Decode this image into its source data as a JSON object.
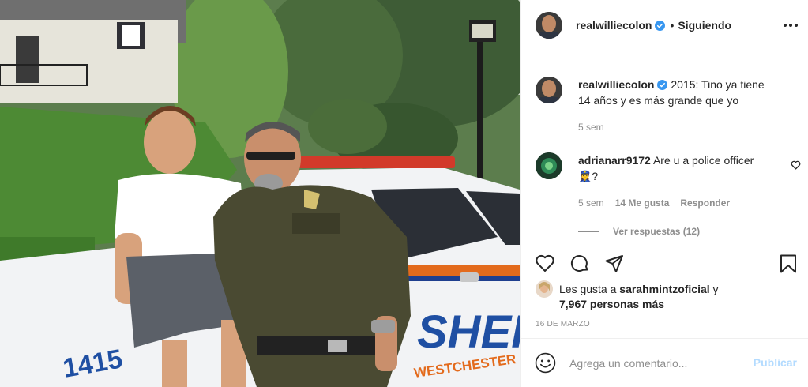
{
  "post": {
    "username": "realwilliecolon",
    "verified": true,
    "follow_separator": "•",
    "follow_label": "Siguiendo",
    "photo_text": {
      "plate_number": "1415",
      "car_label": "SHERIF",
      "car_sublabel": "WESTCHESTER COU"
    }
  },
  "caption": {
    "username": "realwilliecolon",
    "text": "2015: Tino ya tiene 14 años y es más grande que yo",
    "time": "5 sem"
  },
  "comments": [
    {
      "username": "adrianarr9172",
      "text": "Are u a police officer 👮‍♀️?",
      "time": "5 sem",
      "likes": "14 Me gusta",
      "reply_label": "Responder",
      "replies_label": "Ver respuestas (12)"
    }
  ],
  "likes": {
    "prefix": "Les gusta a ",
    "user": "sarahmintzoficial",
    "suffix": " y",
    "others": "7,967 personas más"
  },
  "date": "16 DE MARZO",
  "comment_box": {
    "placeholder": "Agrega un comentario...",
    "publish_label": "Publicar"
  },
  "colors": {
    "verified_blue": "#3897f0",
    "publish_disabled": "#b3dbff",
    "muted_text": "#8e8e8e"
  },
  "icons": [
    "more-options-icon",
    "heart-icon",
    "comment-icon",
    "share-icon",
    "bookmark-icon",
    "emoji-icon",
    "verified-badge-icon"
  ]
}
